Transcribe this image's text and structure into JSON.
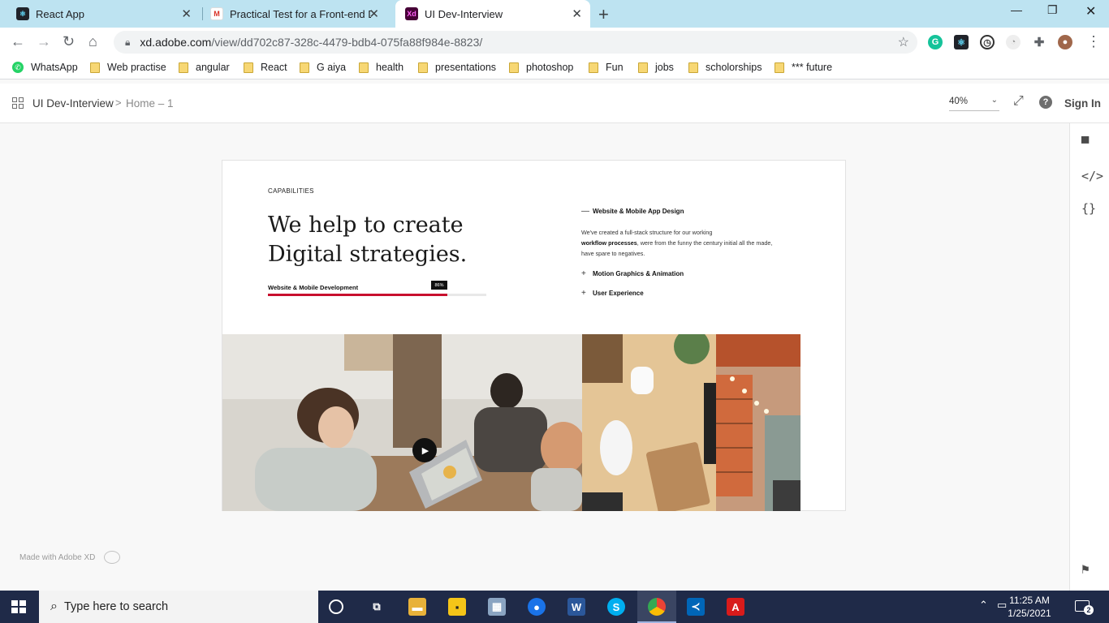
{
  "browser": {
    "tabs": [
      {
        "title": "React App",
        "icon": "react-icon"
      },
      {
        "title": "Practical Test for a Front-end Dev",
        "icon": "gmail-icon"
      },
      {
        "title": "UI Dev-Interview",
        "icon": "adobe-xd-icon",
        "active": true
      }
    ],
    "url_domain": "xd.adobe.com",
    "url_path": "/view/dd702c87-328c-4479-bdb4-075fa88f984e-8823/",
    "bookmarks": [
      "WhatsApp",
      "Web practise",
      "angular",
      "React",
      "G aiya",
      "health",
      "presentations",
      "photoshop",
      "Fun",
      "jobs",
      "scholorships",
      "*** future"
    ]
  },
  "xd": {
    "project": "UI Dev-Interview",
    "separator": ">",
    "page": "Home – 1",
    "zoom": "40%",
    "signin": "Sign In",
    "made_with": "Made with Adobe XD"
  },
  "design": {
    "eyebrow": "CAPABILITIES",
    "headline_1": "We help to create",
    "headline_2": "Digital strategies.",
    "skill_label": "Website & Mobile Development",
    "skill_percent_label": "86%",
    "skill_percent": 82,
    "accordion": [
      {
        "symbol": "—",
        "title": "Website & Mobile App Design",
        "expanded": true
      },
      {
        "symbol": "+",
        "title": "Motion Graphics & Animation",
        "expanded": false
      },
      {
        "symbol": "+",
        "title": "User Experience",
        "expanded": false
      }
    ],
    "accordion_body_pre": "We've created a full-stack structure for our working",
    "accordion_body_bold": "workflow processes",
    "accordion_body_post": ", were from the funny the century initial all the made, have spare to negatives."
  },
  "taskbar": {
    "search_placeholder": "Type here to search",
    "time": "11:25 AM",
    "date": "1/25/2021",
    "notifications": "2"
  },
  "colors": {
    "accent_red": "#c8102e",
    "chrome_tabstrip": "#bde3f1",
    "taskbar": "#1f2a48"
  }
}
